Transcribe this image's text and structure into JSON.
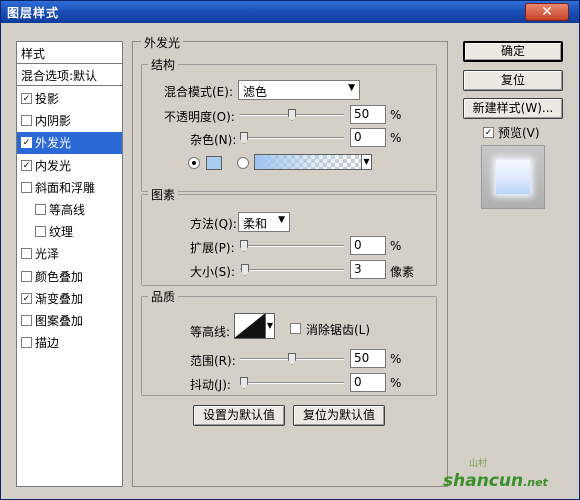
{
  "window": {
    "title": "图层样式"
  },
  "style_list": {
    "header": "样式",
    "blend_options": "混合选项:默认",
    "items": [
      {
        "label": "投影",
        "checked": true
      },
      {
        "label": "内阴影",
        "checked": false
      },
      {
        "label": "外发光",
        "checked": true,
        "selected": true
      },
      {
        "label": "内发光",
        "checked": true
      },
      {
        "label": "斜面和浮雕",
        "checked": false
      },
      {
        "label": "等高线",
        "checked": false,
        "sub": true
      },
      {
        "label": "纹理",
        "checked": false,
        "sub": true
      },
      {
        "label": "光泽",
        "checked": false
      },
      {
        "label": "颜色叠加",
        "checked": false
      },
      {
        "label": "渐变叠加",
        "checked": true
      },
      {
        "label": "图案叠加",
        "checked": false
      },
      {
        "label": "描边",
        "checked": false
      }
    ]
  },
  "panel": {
    "title": "外发光",
    "structure": {
      "label": "结构",
      "blend_mode_label": "混合模式(E):",
      "blend_mode_value": "滤色",
      "opacity_label": "不透明度(O):",
      "opacity_value": "50",
      "noise_label": "杂色(N):",
      "noise_value": "0",
      "unit_percent": "%"
    },
    "elements": {
      "label": "图素",
      "method_label": "方法(Q):",
      "method_value": "柔和",
      "spread_label": "扩展(P):",
      "spread_value": "0",
      "size_label": "大小(S):",
      "size_value": "3",
      "size_unit": "像素",
      "unit_percent": "%"
    },
    "quality": {
      "label": "品质",
      "contour_label": "等高线:",
      "antialias_label": "消除锯齿(L)",
      "range_label": "范围(R):",
      "range_value": "50",
      "jitter_label": "抖动(J):",
      "jitter_value": "0",
      "unit_percent": "%"
    },
    "buttons": {
      "set_default": "设置为默认值",
      "reset_default": "复位为默认值"
    }
  },
  "right": {
    "ok": "确定",
    "reset": "复位",
    "new_style": "新建样式(W)...",
    "preview_label": "预览(V)",
    "preview_checked": true
  },
  "watermark": {
    "text": "shancun",
    "suffix": ".net",
    "sub": "山村"
  },
  "colors": {
    "glow": "#aaccee",
    "selected": "#2b6ad6",
    "title_bar": "#1b50b8"
  },
  "icons": {
    "close": "close-icon",
    "dropdown": "chevron-down-icon"
  }
}
